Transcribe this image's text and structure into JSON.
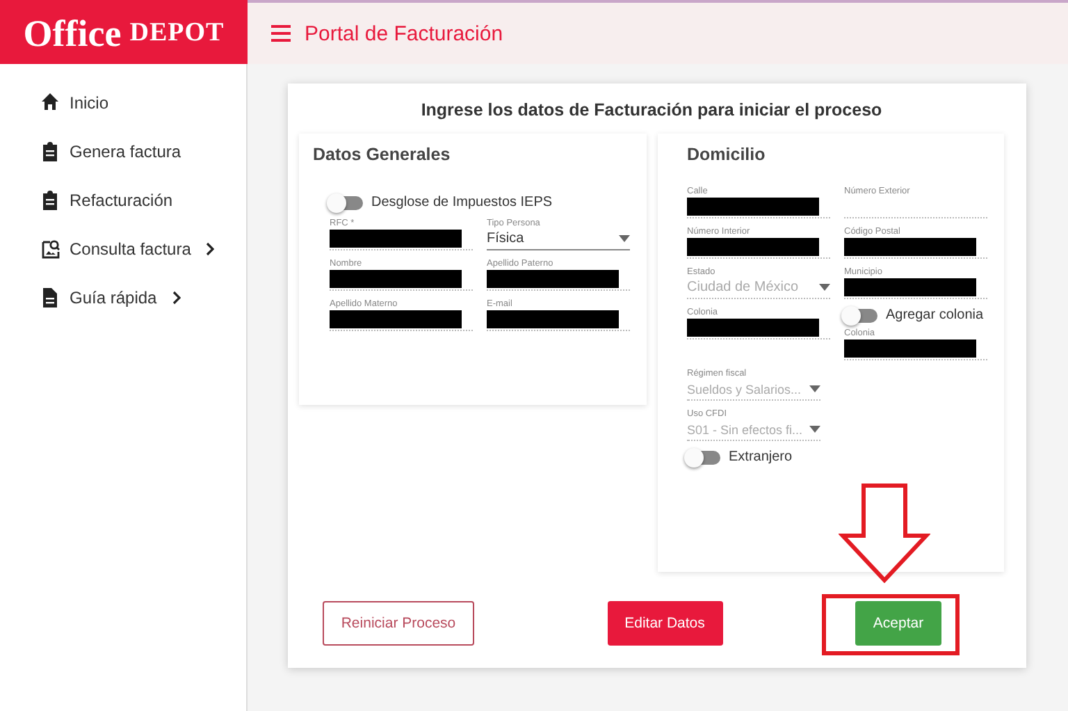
{
  "logo": {
    "word_1": "Office",
    "word_2": "DEPOT"
  },
  "header": {
    "title": "Portal de Facturación"
  },
  "sidebar": {
    "items": [
      {
        "label": "Inicio",
        "submenu": false
      },
      {
        "label": "Genera factura",
        "submenu": false
      },
      {
        "label": "Refacturación",
        "submenu": false
      },
      {
        "label": "Consulta factura",
        "submenu": true
      },
      {
        "label": "Guía rápida",
        "submenu": true
      }
    ]
  },
  "form": {
    "title": "Ingrese los datos de Facturación para iniciar el proceso",
    "panels": [
      {
        "title": "Datos Generales",
        "rows": [
          [
            [
              {
                "kind": "toggle",
                "label": "Desglose de Impuestos IEPS",
                "on": false
              }
            ]
          ],
          [
            [
              {
                "kind": "text",
                "label": "RFC *",
                "redacted": true
              }
            ],
            [
              {
                "kind": "select",
                "label": "Tipo Persona",
                "value": "Física",
                "disabled": false
              }
            ]
          ],
          [
            [
              {
                "kind": "text",
                "label": "Nombre",
                "redacted": true
              }
            ],
            [
              {
                "kind": "text",
                "label": "Apellido Paterno",
                "redacted": true
              }
            ]
          ],
          [
            [
              {
                "kind": "text",
                "label": "Apellido Materno",
                "redacted": true
              }
            ],
            [
              {
                "kind": "text",
                "label": "E-mail",
                "redacted": true
              }
            ]
          ]
        ]
      },
      {
        "title": "Domicilio",
        "rows": [
          [
            [
              {
                "kind": "text",
                "label": "Calle",
                "redacted": true
              }
            ],
            [
              {
                "kind": "text",
                "label": "Número Exterior",
                "redacted": false
              }
            ]
          ],
          [
            [
              {
                "kind": "text",
                "label": "Número Interior",
                "redacted": true
              }
            ],
            [
              {
                "kind": "text",
                "label": "Código Postal",
                "redacted": true
              }
            ]
          ],
          [
            [
              {
                "kind": "select",
                "label": "Estado",
                "value": "Ciudad de México",
                "disabled": true
              }
            ],
            [
              {
                "kind": "text",
                "label": "Municipio",
                "redacted": true
              }
            ]
          ],
          [
            [
              {
                "kind": "text",
                "label": "Colonia",
                "redacted": true
              }
            ],
            [
              {
                "kind": "toggle",
                "label": "Agregar colonia",
                "on": false
              },
              {
                "kind": "text",
                "label": "Colonia",
                "redacted": true
              }
            ]
          ],
          [
            [
              {
                "kind": "select",
                "label": "Régimen fiscal",
                "value": "Sueldos y Salarios...",
                "disabled": true
              }
            ]
          ],
          [
            [
              {
                "kind": "select",
                "label": "Uso CFDI",
                "value": "S01 - Sin efectos fi...",
                "disabled": true
              }
            ]
          ],
          [
            [
              {
                "kind": "toggle",
                "label": "Extranjero",
                "on": false
              }
            ]
          ]
        ]
      }
    ],
    "buttons": [
      {
        "label": "Reiniciar Proceso",
        "kind": "outline"
      },
      {
        "label": "Editar Datos",
        "kind": "primary"
      },
      {
        "label": "Aceptar",
        "kind": "success"
      }
    ]
  },
  "annotations": {
    "arrow": true,
    "highlight": true
  }
}
